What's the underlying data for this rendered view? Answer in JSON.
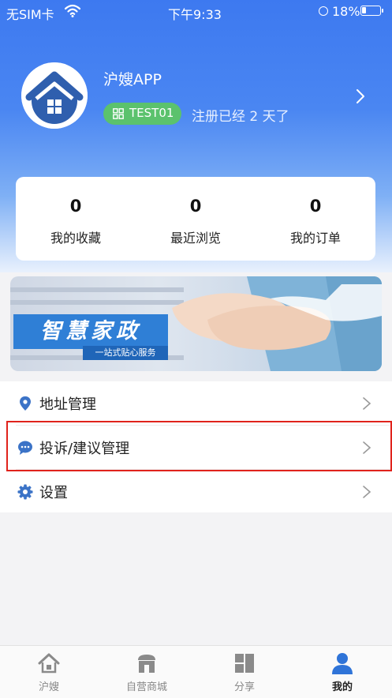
{
  "status_bar": {
    "carrier": "无SIM卡",
    "time": "下午9:33",
    "battery": "18%",
    "battery_level": 0.18
  },
  "profile": {
    "app_name": "沪嫂APP",
    "user_id": "TEST01",
    "registration_text": "注册已经 2 天了"
  },
  "stats": [
    {
      "value": "0",
      "label": "我的收藏"
    },
    {
      "value": "0",
      "label": "最近浏览"
    },
    {
      "value": "0",
      "label": "我的订单"
    }
  ],
  "banner": {
    "title": "智慧家政",
    "subtitle": "一站式贴心服务"
  },
  "menu": [
    {
      "label": "地址管理",
      "icon": "location-pin-icon"
    },
    {
      "label": "投诉/建议管理",
      "icon": "chat-bubble-icon"
    },
    {
      "label": "设置",
      "icon": "gear-icon"
    }
  ],
  "tabs": [
    {
      "label": "沪嫂",
      "icon": "home-icon"
    },
    {
      "label": "自营商城",
      "icon": "store-icon"
    },
    {
      "label": "分享",
      "icon": "share-grid-icon"
    },
    {
      "label": "我的",
      "icon": "user-icon",
      "active": true
    }
  ],
  "colors": {
    "primary_blue": "#3d79f0",
    "chip_green": "#5bc26d",
    "highlight_red": "#e0231c",
    "icon_blue": "#3b73c7"
  }
}
